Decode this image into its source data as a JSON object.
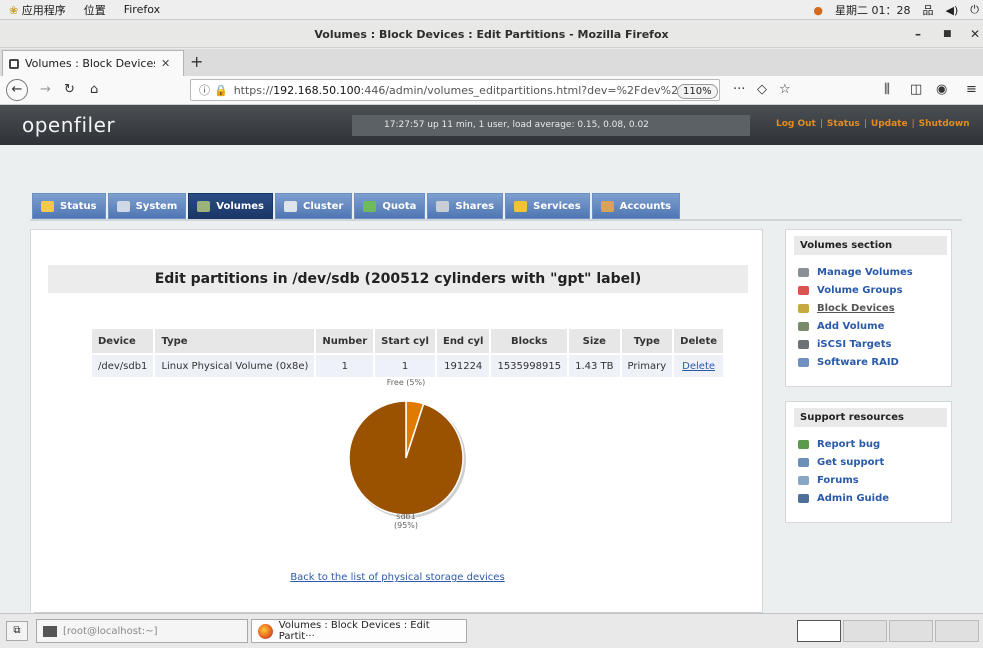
{
  "topbar": {
    "apps": "应用程序",
    "places": "位置",
    "firefox": "Firefox",
    "clock": "星期二 01：28"
  },
  "window": {
    "title": "Volumes : Block Devices : Edit Partitions - Mozilla Firefox"
  },
  "tab": {
    "label": "Volumes : Block Devices",
    "new_tab": "+"
  },
  "nav": {
    "url_prefix": "https://",
    "url_host": "192.168.50.100",
    "url_rest": ":446/admin/volumes_editpartitions.html?dev=%2Fdev%2",
    "zoom": "110%"
  },
  "header": {
    "logo": "openfiler",
    "uptime": "17:27:57 up 11 min, 1 user, load average: 0.15, 0.08, 0.02",
    "links": [
      "Log Out",
      "Status",
      "Update",
      "Shutdown"
    ]
  },
  "tabs": [
    {
      "label": "Status",
      "color": "#f2c94c"
    },
    {
      "label": "System",
      "color": "#cfd8e6"
    },
    {
      "label": "Volumes",
      "color": "#9bb37a"
    },
    {
      "label": "Cluster",
      "color": "#dfe4ea"
    },
    {
      "label": "Quota",
      "color": "#6dbb5a"
    },
    {
      "label": "Shares",
      "color": "#c9ced6"
    },
    {
      "label": "Services",
      "color": "#f4c430"
    },
    {
      "label": "Accounts",
      "color": "#d8a25b"
    }
  ],
  "active_tab": "Volumes",
  "main": {
    "heading": "Edit partitions in /dev/sdb (200512 cylinders with \"gpt\" label)",
    "columns": [
      "Device",
      "Type",
      "Number",
      "Start cyl",
      "End cyl",
      "Blocks",
      "Size",
      "Type",
      "Delete"
    ],
    "rows": [
      [
        "/dev/sdb1",
        "Linux Physical Volume (0x8e)",
        "1",
        "1",
        "191224",
        "1535998915",
        "1.43 TB",
        "Primary",
        "Delete"
      ]
    ],
    "back_link": "Back to the list of physical storage devices"
  },
  "chart_data": {
    "type": "pie",
    "slices": [
      {
        "label": "sdb1",
        "pct_label": "(95%)",
        "value": 95,
        "color": "#9a5200"
      },
      {
        "label": "Free (5%)",
        "value": 5,
        "color": "#e07b00"
      }
    ]
  },
  "volumes_section": {
    "title": "Volumes section",
    "items": [
      {
        "label": "Manage Volumes",
        "icon_color": "#8a8f96",
        "current": false
      },
      {
        "label": "Volume Groups",
        "icon_color": "#d9534f",
        "current": false
      },
      {
        "label": "Block Devices",
        "icon_color": "#c7a842",
        "current": true
      },
      {
        "label": "Add Volume",
        "icon_color": "#7a8b6a",
        "current": false
      },
      {
        "label": "iSCSI Targets",
        "icon_color": "#6d7277",
        "current": false
      },
      {
        "label": "Software RAID",
        "icon_color": "#6f90c0",
        "current": false
      }
    ]
  },
  "support_section": {
    "title": "Support resources",
    "items": [
      {
        "label": "Report bug",
        "icon_color": "#5a9a4a"
      },
      {
        "label": "Get support",
        "icon_color": "#6b8fb8"
      },
      {
        "label": "Forums",
        "icon_color": "#88a6c6"
      },
      {
        "label": "Admin Guide",
        "icon_color": "#4d6f99"
      }
    ]
  },
  "taskbar": {
    "terminal": "[root@localhost:~]",
    "firefox": "Volumes : Block Devices : Edit Partit···"
  }
}
